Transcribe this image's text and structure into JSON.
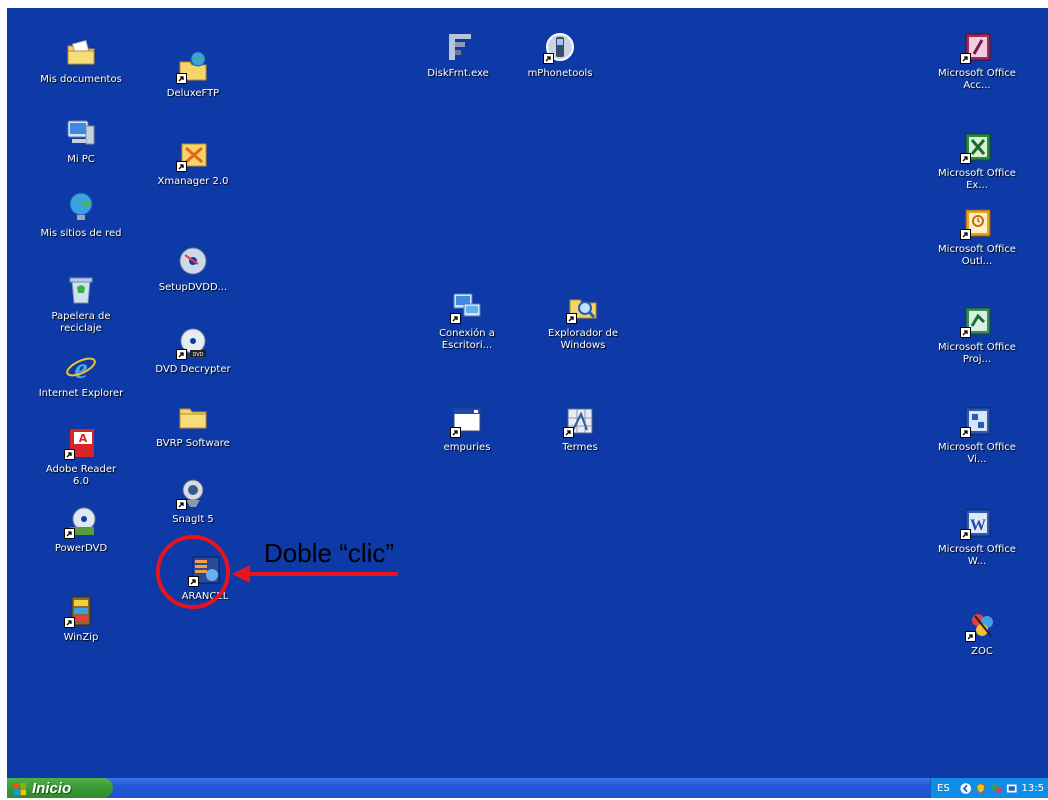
{
  "desktop": {
    "icons": {
      "mis_documentos": "Mis documentos",
      "deluxeftp": "DeluxeFTP",
      "diskfrnt": "DiskFrnt.exe",
      "mphonetools": "mPhonetools",
      "office_access": "Microsoft Office Acc...",
      "mi_pc": "Mi PC",
      "xmanager": "Xmanager 2.0",
      "office_excel": "Microsoft Office Ex...",
      "mis_sitios": "Mis sitios de red",
      "office_outlook": "Microsoft Office Outl...",
      "setupdvdd": "SetupDVDD...",
      "papelera": "Papelera de reciclaje",
      "conexion": "Conexión a Escritori...",
      "explorador": "Explorador de Windows",
      "office_project": "Microsoft Office Proj...",
      "dvd_decrypter": "DVD Decrypter",
      "internet_explorer": "Internet Explorer",
      "bvrp": "BVRP Software",
      "empuries": "empuries",
      "termes": "Termes",
      "office_visio": "Microsoft Office Vi...",
      "adobe_reader": "Adobe Reader 6.0",
      "snagit": "SnagIt 5",
      "powerdvd": "PowerDVD",
      "office_word": "Microsoft Office W...",
      "arancel": "ARANCEL",
      "winzip": "WinZip",
      "zoc": "ZOC"
    }
  },
  "annotation": {
    "text": "Doble “clic”",
    "color": "#e8131b"
  },
  "taskbar": {
    "start_label": "Inicio",
    "language": "ES",
    "clock": "13:5"
  },
  "colors": {
    "desktop": "#0d3aa6",
    "taskbar": "#2458d8",
    "start": "#3a9a35",
    "tray": "#0f8ce6"
  }
}
